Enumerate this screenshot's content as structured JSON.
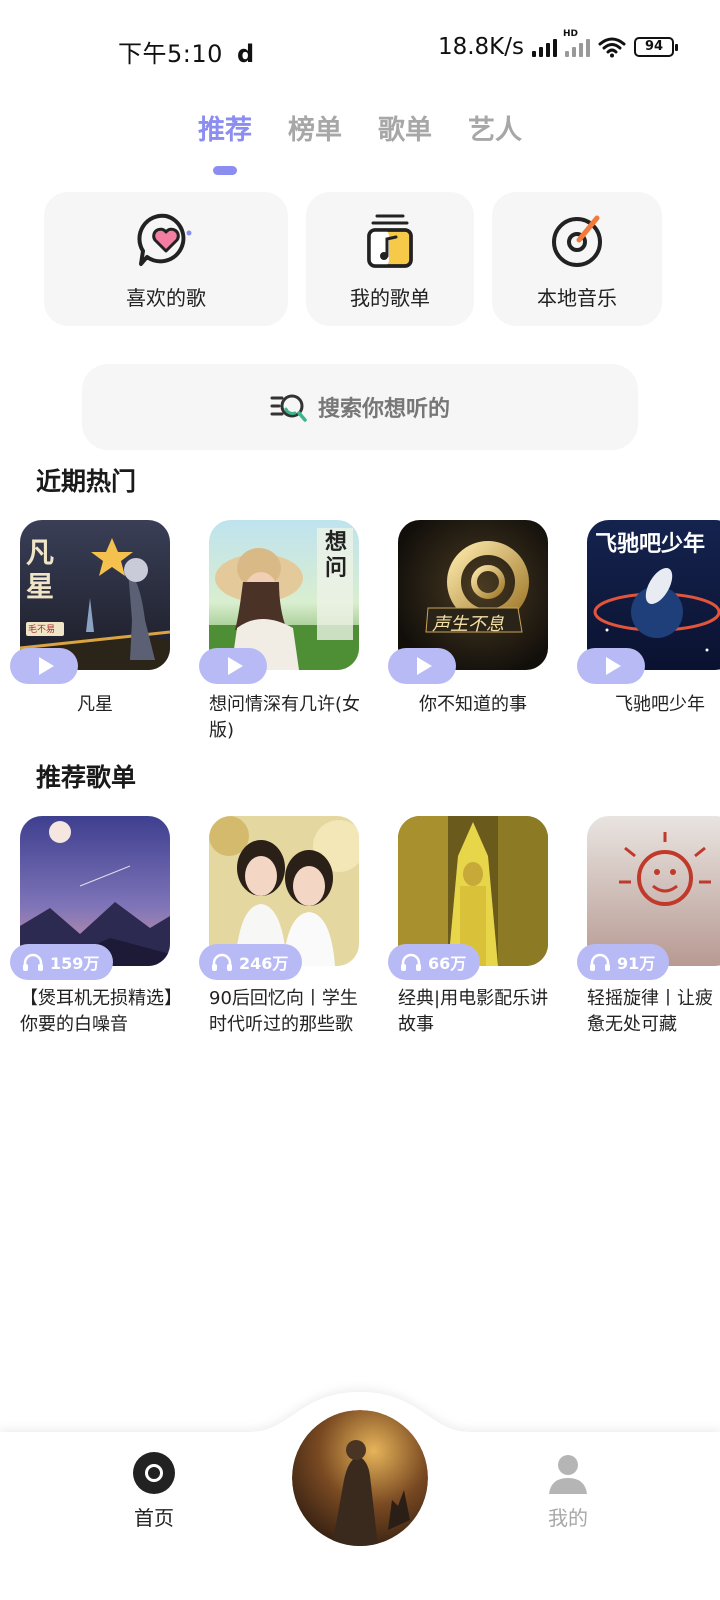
{
  "status": {
    "time": "下午5:10",
    "tiktok_glyph": "d",
    "net_speed": "18.8K/s",
    "battery": "94",
    "hd": "HD"
  },
  "tabs": [
    {
      "label": "推荐",
      "active": true
    },
    {
      "label": "榜单",
      "active": false
    },
    {
      "label": "歌单",
      "active": false
    },
    {
      "label": "艺人",
      "active": false
    }
  ],
  "quick": {
    "liked": "喜欢的歌",
    "my_lists": "我的歌单",
    "local": "本地音乐"
  },
  "search": {
    "placeholder": "搜索你想听的"
  },
  "hot": {
    "title": "近期热门",
    "items": [
      {
        "name": "凡星",
        "cover_text": "凡星",
        "cover_sub": "毛不易"
      },
      {
        "name": "想问情深有几许(女版)",
        "cover_text": "想问"
      },
      {
        "name": "你不知道的事",
        "cover_text": "声生不息"
      },
      {
        "name": "飞驰吧少年",
        "cover_text": "飞驰吧少年"
      }
    ]
  },
  "playlists": {
    "title": "推荐歌单",
    "items": [
      {
        "name": "【煲耳机无损精选】你要的白噪音",
        "count": "159万"
      },
      {
        "name": "90后回忆向丨学生时代听过的那些歌",
        "count": "246万"
      },
      {
        "name": "经典|用电影配乐讲故事",
        "count": "66万"
      },
      {
        "name": "轻摇旋律丨让疲惫无处可藏",
        "count": "91万"
      }
    ]
  },
  "nav": {
    "home": "首页",
    "mine": "我的"
  },
  "colors": {
    "accent": "#8b8ef0",
    "pill": "#b8baf5",
    "card_bg": "#f6f6f6"
  }
}
